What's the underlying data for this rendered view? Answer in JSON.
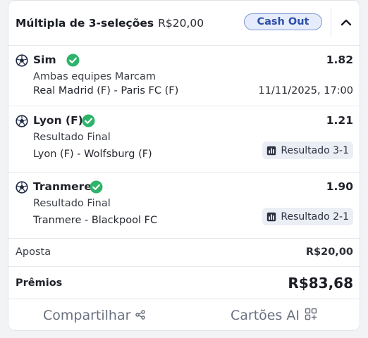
{
  "header": {
    "title": "Múltipla de 3-seleções",
    "amount": "R$20,00",
    "cashout_label": "Cash Out"
  },
  "selections": [
    {
      "name": "Sim",
      "odds": "1.82",
      "market": "Ambas equipes Marcam",
      "event": "Real Madrid (F) - Paris FC (F)",
      "date": "11/11/2025, 17:00"
    },
    {
      "name": "Lyon (F)",
      "odds": "1.21",
      "market": "Resultado Final",
      "event": "Lyon (F) - Wolfsburg (F)",
      "result": "Resultado 3-1"
    },
    {
      "name": "Tranmere",
      "odds": "1.90",
      "market": "Resultado Final",
      "event": "Tranmere - Blackpool FC",
      "result": "Resultado 2-1"
    }
  ],
  "summary": {
    "stake_label": "Aposta",
    "stake_value": "R$20,00",
    "prize_label": "Prêmios",
    "prize_value": "R$83,68"
  },
  "footer": {
    "share_label": "Compartilhar",
    "cards_label": "Cartões AI"
  },
  "colors": {
    "accent": "#2d4fa8",
    "check_green": "#2fb36b",
    "muted": "#6a7180"
  }
}
